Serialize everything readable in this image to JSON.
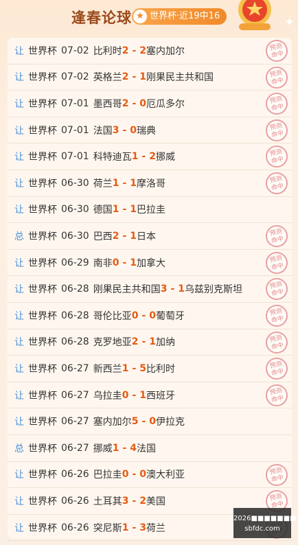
{
  "header": {
    "title": "逢春论球",
    "badge_text": "世界杯·近19中16",
    "badge_icon": "star-icon"
  },
  "colors": {
    "accent": "#e55a12",
    "tag": "#4a8fd8",
    "title": "#9b4a1c"
  },
  "stamp_text": "预测命中",
  "rows": [
    {
      "tag": "让",
      "league": "世界杯",
      "date": "07-02",
      "home": "比利时",
      "home_score": "2",
      "away_score": "2",
      "away": "塞内加尔",
      "hit": true
    },
    {
      "tag": "让",
      "league": "世界杯",
      "date": "07-02",
      "home": "英格兰",
      "home_score": "2",
      "away_score": "1",
      "away": "刚果民主共和国",
      "hit": true
    },
    {
      "tag": "让",
      "league": "世界杯",
      "date": "07-01",
      "home": "墨西哥",
      "home_score": "2",
      "away_score": "0",
      "away": "厄瓜多尔",
      "hit": true
    },
    {
      "tag": "让",
      "league": "世界杯",
      "date": "07-01",
      "home": "法国",
      "home_score": "3",
      "away_score": "0",
      "away": "瑞典",
      "hit": true
    },
    {
      "tag": "让",
      "league": "世界杯",
      "date": "07-01",
      "home": "科特迪瓦",
      "home_score": "1",
      "away_score": "2",
      "away": "挪威",
      "hit": true
    },
    {
      "tag": "让",
      "league": "世界杯",
      "date": "06-30",
      "home": "荷兰",
      "home_score": "1",
      "away_score": "1",
      "away": "摩洛哥",
      "hit": true
    },
    {
      "tag": "让",
      "league": "世界杯",
      "date": "06-30",
      "home": "德国",
      "home_score": "1",
      "away_score": "1",
      "away": "巴拉圭",
      "hit": false
    },
    {
      "tag": "总",
      "league": "世界杯",
      "date": "06-30",
      "home": "巴西",
      "home_score": "2",
      "away_score": "1",
      "away": "日本",
      "hit": true
    },
    {
      "tag": "让",
      "league": "世界杯",
      "date": "06-29",
      "home": "南非",
      "home_score": "0",
      "away_score": "1",
      "away": "加拿大",
      "hit": true
    },
    {
      "tag": "让",
      "league": "世界杯",
      "date": "06-28",
      "home": "刚果民主共和国",
      "home_score": "3",
      "away_score": "1",
      "away": "乌兹别克斯坦",
      "hit": true
    },
    {
      "tag": "让",
      "league": "世界杯",
      "date": "06-28",
      "home": "哥伦比亚",
      "home_score": "0",
      "away_score": "0",
      "away": "葡萄牙",
      "hit": true
    },
    {
      "tag": "让",
      "league": "世界杯",
      "date": "06-28",
      "home": "克罗地亚",
      "home_score": "2",
      "away_score": "1",
      "away": "加纳",
      "hit": true
    },
    {
      "tag": "让",
      "league": "世界杯",
      "date": "06-27",
      "home": "新西兰",
      "home_score": "1",
      "away_score": "5",
      "away": "比利时",
      "hit": true
    },
    {
      "tag": "让",
      "league": "世界杯",
      "date": "06-27",
      "home": "乌拉圭",
      "home_score": "0",
      "away_score": "1",
      "away": "西班牙",
      "hit": true
    },
    {
      "tag": "让",
      "league": "世界杯",
      "date": "06-27",
      "home": "塞内加尔",
      "home_score": "5",
      "away_score": "0",
      "away": "伊拉克",
      "hit": false
    },
    {
      "tag": "总",
      "league": "世界杯",
      "date": "06-27",
      "home": "挪威",
      "home_score": "1",
      "away_score": "4",
      "away": "法国",
      "hit": false
    },
    {
      "tag": "让",
      "league": "世界杯",
      "date": "06-26",
      "home": "巴拉圭",
      "home_score": "0",
      "away_score": "0",
      "away": "澳大利亚",
      "hit": true
    },
    {
      "tag": "让",
      "league": "世界杯",
      "date": "06-26",
      "home": "土耳其",
      "home_score": "3",
      "away_score": "2",
      "away": "美国",
      "hit": true
    },
    {
      "tag": "让",
      "league": "世界杯",
      "date": "06-26",
      "home": "突尼斯",
      "home_score": "1",
      "away_score": "3",
      "away": "荷兰",
      "hit": true
    }
  ],
  "watermark": {
    "line1": "2026■■■■■■■",
    "line2": "sbfdc.com"
  }
}
